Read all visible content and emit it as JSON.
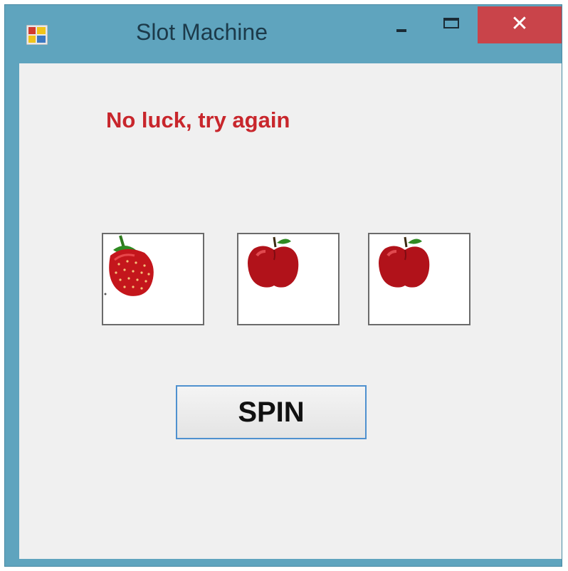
{
  "window": {
    "title": "Slot Machine",
    "app_icon": "winforms-app-icon",
    "controls": {
      "minimize_icon": "minimize-icon",
      "maximize_icon": "maximize-icon",
      "close_icon": "close-icon",
      "close_glyph": "✕"
    }
  },
  "status": {
    "message": "No luck, try again",
    "color": "#c8262c"
  },
  "reels": [
    {
      "fruit": "strawberry"
    },
    {
      "fruit": "apple"
    },
    {
      "fruit": "apple"
    }
  ],
  "spin_button": {
    "label": "SPIN"
  },
  "colors": {
    "frame": "#5fa4be",
    "close": "#c9444a",
    "client": "#f0f0f0",
    "button_border": "#4f91cf"
  }
}
